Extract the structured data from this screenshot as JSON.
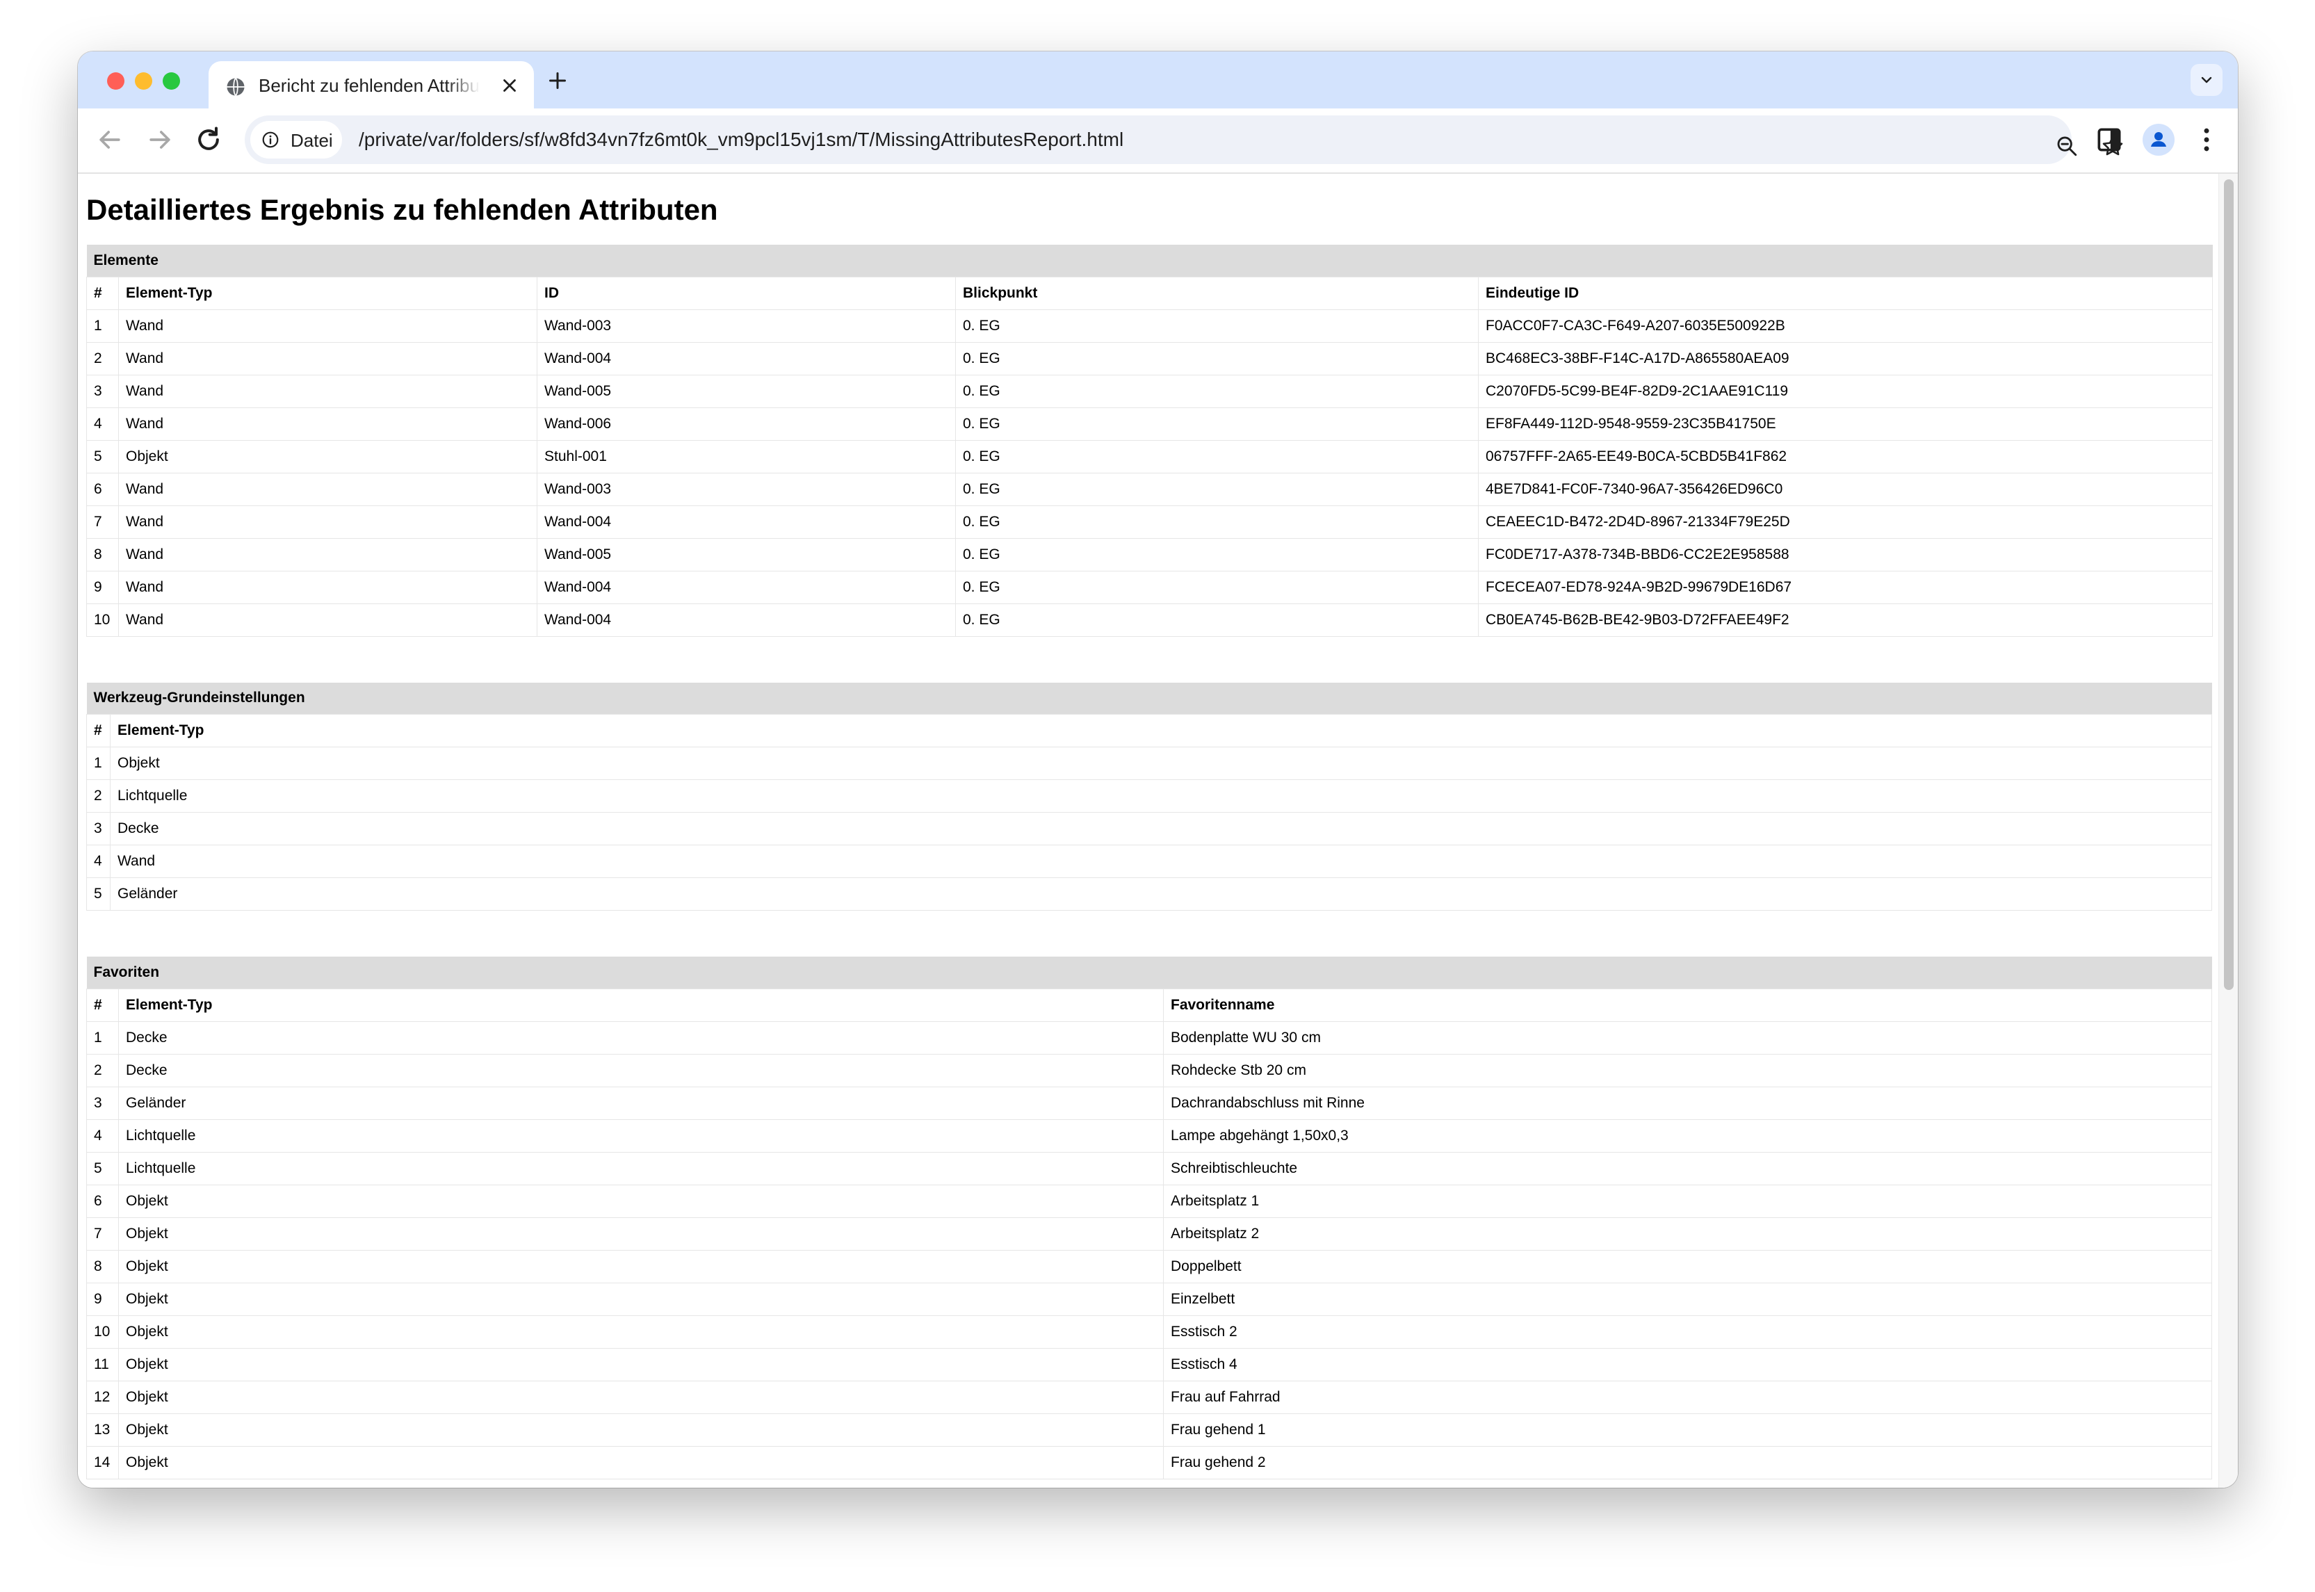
{
  "browser": {
    "tab_title": "Bericht zu fehlenden Attributen",
    "site_chip_label": "Datei",
    "url": "/private/var/folders/sf/w8fd34vn7fz6mt0k_vm9pcl15vj1sm/T/MissingAttributesReport.html",
    "icons": [
      "globe-icon",
      "close-icon",
      "plus-icon",
      "chevron-down-icon",
      "back-arrow-icon",
      "forward-arrow-icon",
      "reload-icon",
      "info-icon",
      "zoom-icon",
      "star-icon",
      "side-panel-icon",
      "profile-icon",
      "more-vert-icon"
    ]
  },
  "report": {
    "title": "Detailliertes Ergebnis zu fehlenden Attributen",
    "elements": {
      "heading": "Elemente",
      "columns": [
        "#",
        "Element-Typ",
        "ID",
        "Blickpunkt",
        "Eindeutige ID"
      ],
      "rows": [
        [
          "1",
          "Wand",
          "Wand-003",
          "0. EG",
          "F0ACC0F7-CA3C-F649-A207-6035E500922B"
        ],
        [
          "2",
          "Wand",
          "Wand-004",
          "0. EG",
          "BC468EC3-38BF-F14C-A17D-A865580AEA09"
        ],
        [
          "3",
          "Wand",
          "Wand-005",
          "0. EG",
          "C2070FD5-5C99-BE4F-82D9-2C1AAE91C119"
        ],
        [
          "4",
          "Wand",
          "Wand-006",
          "0. EG",
          "EF8FA449-112D-9548-9559-23C35B41750E"
        ],
        [
          "5",
          "Objekt",
          "Stuhl-001",
          "0. EG",
          "06757FFF-2A65-EE49-B0CA-5CBD5B41F862"
        ],
        [
          "6",
          "Wand",
          "Wand-003",
          "0. EG",
          "4BE7D841-FC0F-7340-96A7-356426ED96C0"
        ],
        [
          "7",
          "Wand",
          "Wand-004",
          "0. EG",
          "CEAEEC1D-B472-2D4D-8967-21334F79E25D"
        ],
        [
          "8",
          "Wand",
          "Wand-005",
          "0. EG",
          "FC0DE717-A378-734B-BBD6-CC2E2E958588"
        ],
        [
          "9",
          "Wand",
          "Wand-004",
          "0. EG",
          "FCECEA07-ED78-924A-9B2D-99679DE16D67"
        ],
        [
          "10",
          "Wand",
          "Wand-004",
          "0. EG",
          "CB0EA745-B62B-BE42-9B03-D72FFAEE49F2"
        ]
      ]
    },
    "tool_defaults": {
      "heading": "Werkzeug-Grundeinstellungen",
      "columns": [
        "#",
        "Element-Typ"
      ],
      "rows": [
        [
          "1",
          "Objekt"
        ],
        [
          "2",
          "Lichtquelle"
        ],
        [
          "3",
          "Decke"
        ],
        [
          "4",
          "Wand"
        ],
        [
          "5",
          "Geländer"
        ]
      ]
    },
    "favorites": {
      "heading": "Favoriten",
      "columns": [
        "#",
        "Element-Typ",
        "Favoritenname"
      ],
      "rows": [
        [
          "1",
          "Decke",
          "Bodenplatte WU 30 cm"
        ],
        [
          "2",
          "Decke",
          "Rohdecke Stb 20 cm"
        ],
        [
          "3",
          "Geländer",
          "Dachrandabschluss mit Rinne"
        ],
        [
          "4",
          "Lichtquelle",
          "Lampe abgehängt 1,50x0,3"
        ],
        [
          "5",
          "Lichtquelle",
          "Schreibtischleuchte"
        ],
        [
          "6",
          "Objekt",
          "Arbeitsplatz 1"
        ],
        [
          "7",
          "Objekt",
          "Arbeitsplatz 2"
        ],
        [
          "8",
          "Objekt",
          "Doppelbett"
        ],
        [
          "9",
          "Objekt",
          "Einzelbett"
        ],
        [
          "10",
          "Objekt",
          "Esstisch 2"
        ],
        [
          "11",
          "Objekt",
          "Esstisch 4"
        ],
        [
          "12",
          "Objekt",
          "Frau auf Fahrrad"
        ],
        [
          "13",
          "Objekt",
          "Frau gehend 1"
        ],
        [
          "14",
          "Objekt",
          "Frau gehend 2"
        ]
      ]
    }
  }
}
